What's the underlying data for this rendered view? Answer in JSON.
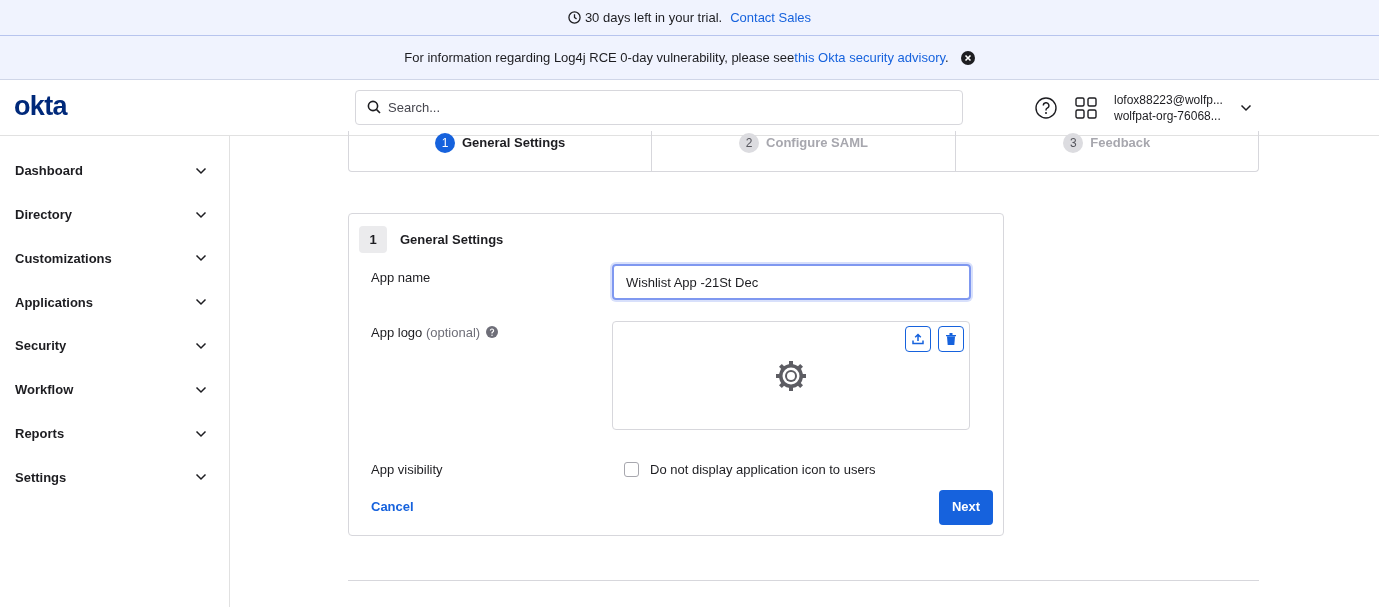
{
  "trial_banner": {
    "text": "30 days left in your trial.",
    "link": "Contact Sales"
  },
  "advisory_banner": {
    "text": "For information regarding Log4j RCE 0-day vulnerability, please see",
    "link": "this Okta security advisory",
    "suffix": "."
  },
  "header": {
    "logo": "okta",
    "search": {
      "placeholder": "Search..."
    },
    "user": {
      "email": "lofox88223@wolfp...",
      "org": "wolfpat-org-76068..."
    }
  },
  "sidebar": {
    "items": [
      {
        "label": "Dashboard",
        "expanded": false
      },
      {
        "label": "Directory",
        "expanded": false
      },
      {
        "label": "Customizations",
        "expanded": false
      },
      {
        "label": "Applications",
        "expanded": false
      },
      {
        "label": "Security",
        "expanded": false
      },
      {
        "label": "Workflow",
        "expanded": false
      },
      {
        "label": "Reports",
        "expanded": false
      },
      {
        "label": "Settings",
        "expanded": false
      }
    ]
  },
  "steps": [
    {
      "number": "1",
      "label": "General Settings",
      "selected": true
    },
    {
      "number": "2",
      "label": "Configure SAML",
      "selected": false
    },
    {
      "number": "3",
      "label": "Feedback",
      "selected": false
    }
  ],
  "form": {
    "step_number": "1",
    "title": "General Settings",
    "app_name": {
      "label": "App name",
      "value": "Wishlist App -21St Dec"
    },
    "app_logo": {
      "label": "App logo",
      "hint": "(optional)"
    },
    "app_visibility": {
      "label": "App visibility",
      "option": "Do not display application icon to users",
      "checked": false
    },
    "cancel": "Cancel",
    "next": "Next"
  }
}
